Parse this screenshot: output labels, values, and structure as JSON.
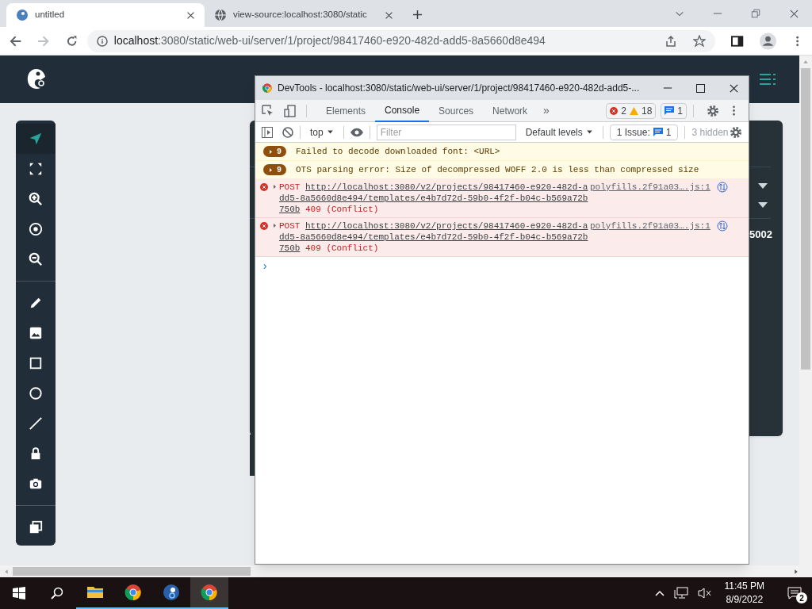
{
  "browser": {
    "tabs": [
      {
        "title": "untitled",
        "selected": true
      },
      {
        "title": "view-source:localhost:3080/static",
        "selected": false
      }
    ],
    "address": {
      "host": "localhost",
      "path": ":3080/static/web-ui/server/1/project/98417460-e920-482d-add5-8a5660d8e494"
    }
  },
  "app": {
    "tool_groups": [
      [
        {
          "kind": "pointer",
          "selected": true
        },
        {
          "kind": "fit",
          "selected": false
        },
        {
          "kind": "zoomin",
          "selected": false
        },
        {
          "kind": "target",
          "selected": false
        },
        {
          "kind": "zoomout",
          "selected": false
        }
      ],
      [
        {
          "kind": "pencil",
          "selected": false
        },
        {
          "kind": "image",
          "selected": false
        },
        {
          "kind": "rect",
          "selected": false
        },
        {
          "kind": "ellipse",
          "selected": false
        },
        {
          "kind": "line",
          "selected": false
        },
        {
          "kind": "lock",
          "selected": false
        },
        {
          "kind": "camera",
          "selected": false
        }
      ],
      [
        {
          "kind": "layers",
          "selected": false
        }
      ]
    ],
    "panel_value": "5002"
  },
  "devtools": {
    "title": "DevTools - localhost:3080/static/web-ui/server/1/project/98417460-e920-482d-add5-...",
    "tabs": [
      {
        "label": "Elements",
        "selected": false
      },
      {
        "label": "Console",
        "selected": true
      },
      {
        "label": "Sources",
        "selected": false
      },
      {
        "label": "Network",
        "selected": false
      }
    ],
    "more": "»",
    "errors": "2",
    "warnings": "18",
    "messages": "1",
    "context": "top",
    "filter": {
      "placeholder": "Filter"
    },
    "levels": "Default levels",
    "issues_label": "1 Issue:",
    "issues_count": "1",
    "hidden": "3 hidden",
    "console": [
      {
        "kind": "warning",
        "count": "9",
        "text": "Failed to decode downloaded font: <URL>"
      },
      {
        "kind": "warning",
        "count": "9",
        "text": "OTS parsing error: Size of decompressed WOFF 2.0 is less than compressed size"
      },
      {
        "kind": "error",
        "method": "POST",
        "url": "http://localhost:3080/v2/projects/98417460-e920-482d-add5-8a5660d8e494/templates/e4b7d72d-59b0-4f2f-b04c-b569a72b750b",
        "status": "409 (Conflict)",
        "source": "polyfills.2f91a03….js:1"
      },
      {
        "kind": "error",
        "method": "POST",
        "url": "http://localhost:3080/v2/projects/98417460-e920-482d-add5-8a5660d8e494/templates/e4b7d72d-59b0-4f2f-b04c-b569a72b750b",
        "status": "409 (Conflict)",
        "source": "polyfills.2f91a03….js:1"
      }
    ],
    "prompt": "›"
  },
  "taskbar": {
    "apps": [
      {
        "kind": "folder",
        "selected": false
      },
      {
        "kind": "chrome",
        "selected": false
      },
      {
        "kind": "app",
        "selected": false
      },
      {
        "kind": "chrome",
        "selected": true
      }
    ],
    "time": "11:45 PM",
    "date": "8/9/2022",
    "notifications": "2"
  }
}
